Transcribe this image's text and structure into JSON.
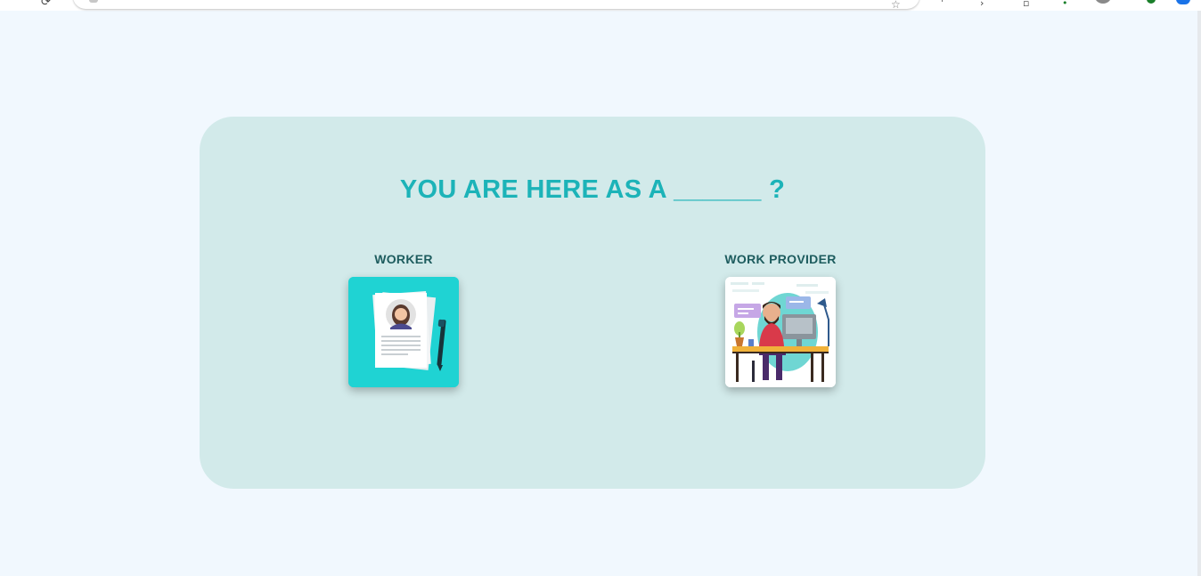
{
  "page": {
    "question": "YOU ARE HERE AS A ______ ?",
    "background_color": "#f1f8fe",
    "panel_color": "#d2eaea",
    "accent_color": "#1cb3b8"
  },
  "options": [
    {
      "label": "WORKER",
      "image_icon": "resume-document-icon",
      "tile_color": "#1fd3d3"
    },
    {
      "label": "WORK PROVIDER",
      "image_icon": "person-at-desk-illustration",
      "tile_color": "#ffffff"
    }
  ]
}
